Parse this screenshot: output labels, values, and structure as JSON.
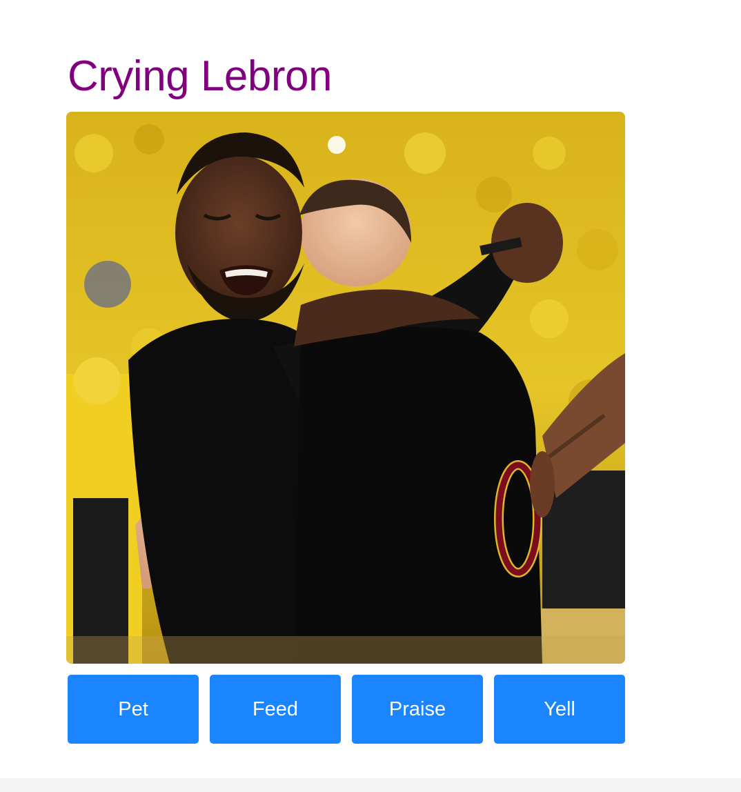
{
  "header": {
    "title": "Crying Lebron"
  },
  "photo": {
    "subject": "lebron-james-crying-hug"
  },
  "actions": [
    {
      "id": "pet",
      "label": "Pet"
    },
    {
      "id": "feed",
      "label": "Feed"
    },
    {
      "id": "praise",
      "label": "Praise"
    },
    {
      "id": "yell",
      "label": "Yell"
    }
  ],
  "colors": {
    "title": "#800080",
    "button": "#1a85ff",
    "jersey": "#0c0c0c",
    "jersey_number": "#7a0e1f",
    "crowd": "#e3c21a"
  }
}
